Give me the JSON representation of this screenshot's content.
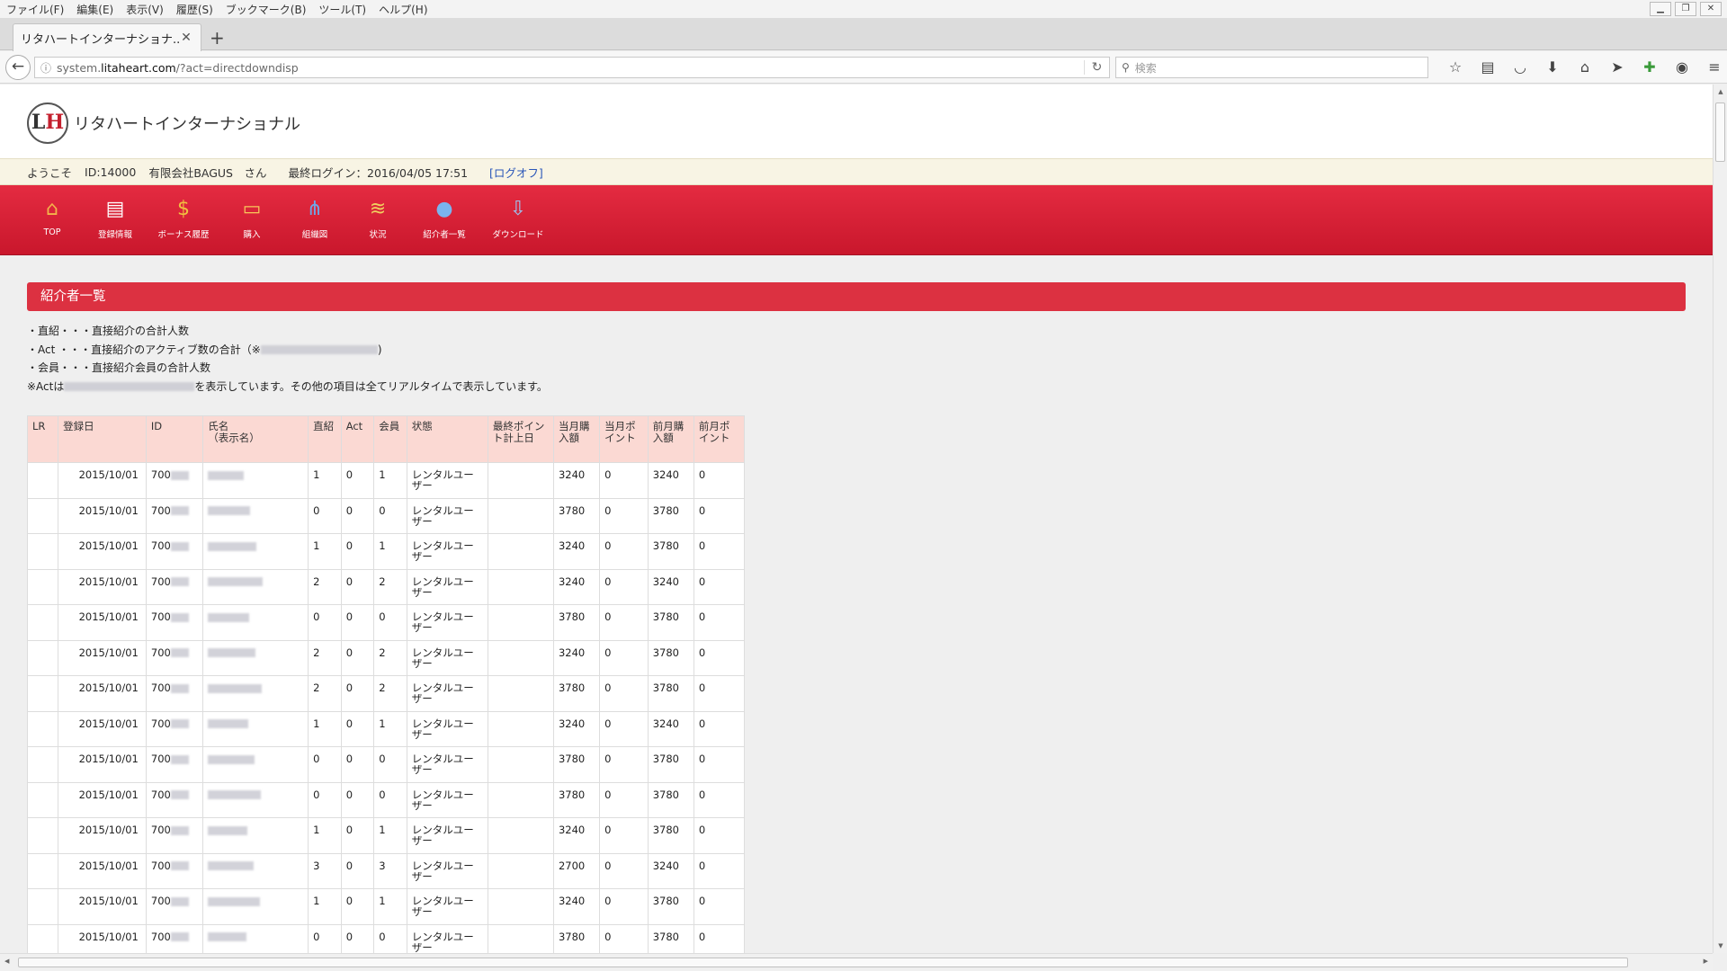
{
  "menu": [
    "ファイル(F)",
    "編集(E)",
    "表示(V)",
    "履歴(S)",
    "ブックマーク(B)",
    "ツール(T)",
    "ヘルプ(H)"
  ],
  "tab": {
    "title": "リタハートインターナショナ..."
  },
  "url": {
    "prefix": "system.",
    "domain": "litaheart.com",
    "path": "/?act=directdowndisp"
  },
  "search": {
    "placeholder": "検索"
  },
  "company": "リタハートインターナショナル",
  "welcome": {
    "greeting": "ようこそ",
    "id": "ID:14000",
    "name": "有限会社BAGUS　さん",
    "last_login": "最終ログイン：2016/04/05 17:51",
    "logoff": "[ログオフ]"
  },
  "nav": [
    {
      "label": "TOP",
      "icon": "home-icon",
      "glyph": "⌂"
    },
    {
      "label": "登録情報",
      "icon": "book-icon",
      "glyph": "▤"
    },
    {
      "label": "ボーナス履歴",
      "icon": "moneybag-icon",
      "glyph": "$"
    },
    {
      "label": "購入",
      "icon": "folder-icon",
      "glyph": "▭"
    },
    {
      "label": "組織図",
      "icon": "org-chart-icon",
      "glyph": "⋔"
    },
    {
      "label": "状況",
      "icon": "chart-icon",
      "glyph": "≋"
    },
    {
      "label": "紹介者一覧",
      "icon": "users-icon",
      "glyph": "●"
    },
    {
      "label": "ダウンロード",
      "icon": "download-icon",
      "glyph": "⇩"
    }
  ],
  "section_title": "紹介者一覧",
  "notes": [
    "・直紹・・・直接紹介の合計人数",
    "・Act ・・・直接紹介のアクティブ数の合計（※",
    "・会員・・・直接紹介会員の合計人数",
    "※Actは"
  ],
  "notes_tail": [
    ")",
    "を表示しています。その他の項目は全てリアルタイムで表示しています。"
  ],
  "table": {
    "headers": [
      "LR",
      "登録日",
      "ID",
      "氏名\n（表示名）",
      "直紹",
      "Act",
      "会員",
      "状態",
      "最終ポイント計上日",
      "当月購入額",
      "当月ポイント",
      "前月購入額",
      "前月ポイント"
    ],
    "rows": [
      [
        "",
        "2015/10/01",
        "700",
        "",
        "1",
        "0",
        "1",
        "レンタルユーザー",
        "",
        "3240",
        "0",
        "3240",
        "0"
      ],
      [
        "",
        "2015/10/01",
        "700",
        "",
        "0",
        "0",
        "0",
        "レンタルユーザー",
        "",
        "3780",
        "0",
        "3780",
        "0"
      ],
      [
        "",
        "2015/10/01",
        "700",
        "",
        "1",
        "0",
        "1",
        "レンタルユーザー",
        "",
        "3240",
        "0",
        "3780",
        "0"
      ],
      [
        "",
        "2015/10/01",
        "700",
        "",
        "2",
        "0",
        "2",
        "レンタルユーザー",
        "",
        "3240",
        "0",
        "3240",
        "0"
      ],
      [
        "",
        "2015/10/01",
        "700",
        "",
        "0",
        "0",
        "0",
        "レンタルユーザー",
        "",
        "3780",
        "0",
        "3780",
        "0"
      ],
      [
        "",
        "2015/10/01",
        "700",
        "",
        "2",
        "0",
        "2",
        "レンタルユーザー",
        "",
        "3240",
        "0",
        "3780",
        "0"
      ],
      [
        "",
        "2015/10/01",
        "700",
        "",
        "2",
        "0",
        "2",
        "レンタルユーザー",
        "",
        "3780",
        "0",
        "3780",
        "0"
      ],
      [
        "",
        "2015/10/01",
        "700",
        "",
        "1",
        "0",
        "1",
        "レンタルユーザー",
        "",
        "3240",
        "0",
        "3240",
        "0"
      ],
      [
        "",
        "2015/10/01",
        "700",
        "",
        "0",
        "0",
        "0",
        "レンタルユーザー",
        "",
        "3780",
        "0",
        "3780",
        "0"
      ],
      [
        "",
        "2015/10/01",
        "700",
        "",
        "0",
        "0",
        "0",
        "レンタルユーザー",
        "",
        "3780",
        "0",
        "3780",
        "0"
      ],
      [
        "",
        "2015/10/01",
        "700",
        "",
        "1",
        "0",
        "1",
        "レンタルユーザー",
        "",
        "3240",
        "0",
        "3780",
        "0"
      ],
      [
        "",
        "2015/10/01",
        "700",
        "",
        "3",
        "0",
        "3",
        "レンタルユーザー",
        "",
        "2700",
        "0",
        "3240",
        "0"
      ],
      [
        "",
        "2015/10/01",
        "700",
        "",
        "1",
        "0",
        "1",
        "レンタルユーザー",
        "",
        "3240",
        "0",
        "3780",
        "0"
      ],
      [
        "",
        "2015/10/01",
        "700",
        "",
        "0",
        "0",
        "0",
        "レンタルユーザー",
        "",
        "3780",
        "0",
        "3780",
        "0"
      ]
    ]
  },
  "colors": {
    "brand_red": "#dc3141",
    "header_cell": "#fbd9d3",
    "welcome_bg": "#f8f4e4"
  }
}
